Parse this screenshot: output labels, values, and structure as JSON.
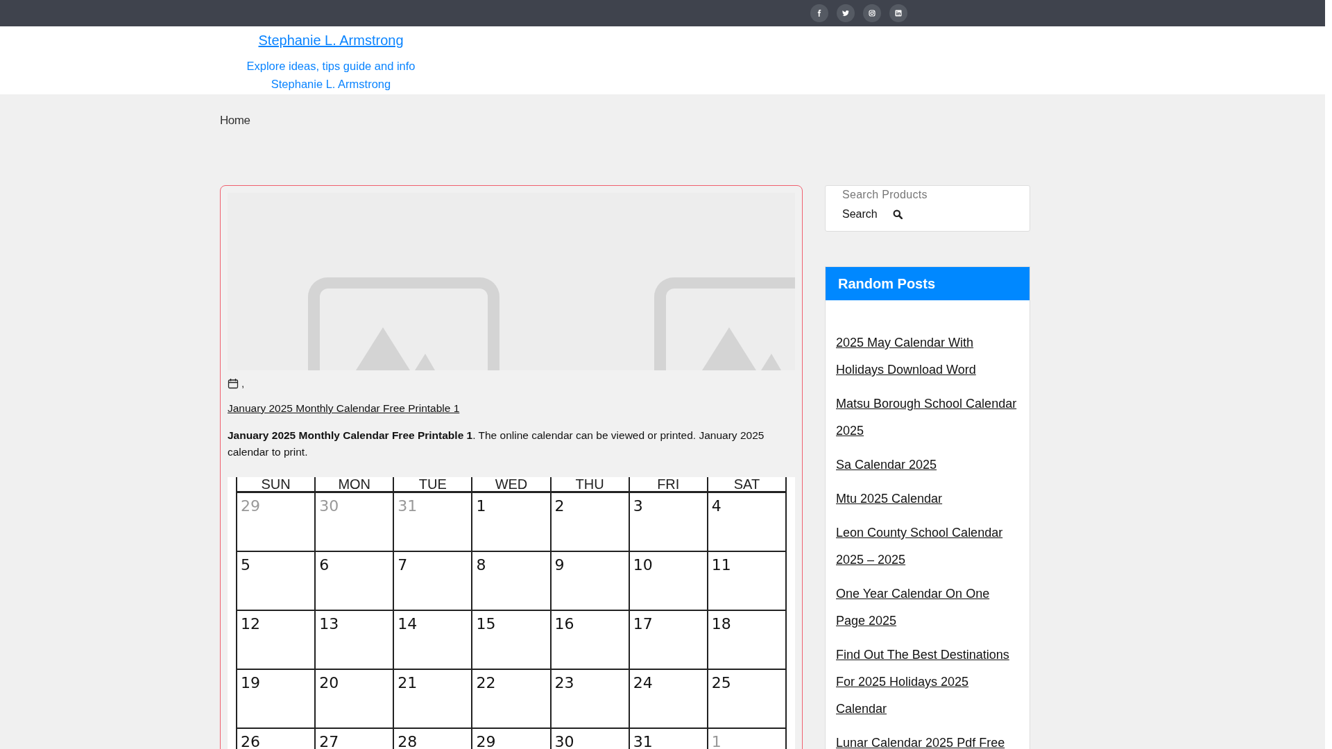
{
  "topbar": {
    "social": [
      {
        "kind": "facebook"
      },
      {
        "kind": "twitter"
      },
      {
        "kind": "instagram"
      },
      {
        "kind": "linkedin"
      }
    ]
  },
  "header": {
    "site_title": "Stephanie L. Armstrong",
    "tagline": "Explore ideas, tips guide and info",
    "tagline_2": "Stephanie L. Armstrong"
  },
  "nav": [
    {
      "label": "Home"
    }
  ],
  "post": {
    "meta": ",",
    "title": "January 2025 Monthly Calendar Free Printable 1",
    "excerpt": "**January 2025 Monthly Calendar Free Printable 1**. The online calendar can be viewed or printed. January 2025 calendar to print.",
    "calendar": {
      "weekdays": [
        "SUN",
        "MON",
        "TUE",
        "WED",
        "THU",
        "FRI",
        "SAT"
      ],
      "weeks": [
        [
          {
            "day": "29",
            "outside": true
          },
          {
            "day": "30",
            "outside": true
          },
          {
            "day": "31",
            "outside": true
          },
          {
            "day": "1",
            "outside": false
          },
          {
            "day": "2",
            "outside": false
          },
          {
            "day": "3",
            "outside": false
          },
          {
            "day": "4",
            "outside": false
          }
        ],
        [
          {
            "day": "5",
            "outside": false
          },
          {
            "day": "6",
            "outside": false
          },
          {
            "day": "7",
            "outside": false
          },
          {
            "day": "8",
            "outside": false
          },
          {
            "day": "9",
            "outside": false
          },
          {
            "day": "10",
            "outside": false
          },
          {
            "day": "11",
            "outside": false
          }
        ],
        [
          {
            "day": "12",
            "outside": false
          },
          {
            "day": "13",
            "outside": false
          },
          {
            "day": "14",
            "outside": false
          },
          {
            "day": "15",
            "outside": false
          },
          {
            "day": "16",
            "outside": false
          },
          {
            "day": "17",
            "outside": false
          },
          {
            "day": "18",
            "outside": false
          }
        ],
        [
          {
            "day": "19",
            "outside": false
          },
          {
            "day": "20",
            "outside": false
          },
          {
            "day": "21",
            "outside": false
          },
          {
            "day": "22",
            "outside": false
          },
          {
            "day": "23",
            "outside": false
          },
          {
            "day": "24",
            "outside": false
          },
          {
            "day": "25",
            "outside": false
          }
        ],
        [
          {
            "day": "26",
            "outside": false
          },
          {
            "day": "27",
            "outside": false
          },
          {
            "day": "28",
            "outside": false
          },
          {
            "day": "29",
            "outside": false
          },
          {
            "day": "30",
            "outside": false
          },
          {
            "day": "31",
            "outside": false
          },
          {
            "day": "1",
            "outside": true
          }
        ]
      ]
    }
  },
  "sidebar": {
    "search": {
      "placeholder": "Search Products",
      "button": "Search"
    },
    "random_posts": {
      "title": "Random Posts",
      "items": [
        "2025 May Calendar With Holidays Download Word",
        "Matsu Borough School Calendar 2025",
        "Sa Calendar 2025",
        "Mtu 2025 Calendar",
        "Leon County School Calendar 2025 – 2025",
        "One Year Calendar On One Page 2025",
        "Find Out The Best Destinations For 2025 Holidays 2025 Calendar",
        "Lunar Calendar 2025 Pdf Free"
      ]
    }
  }
}
